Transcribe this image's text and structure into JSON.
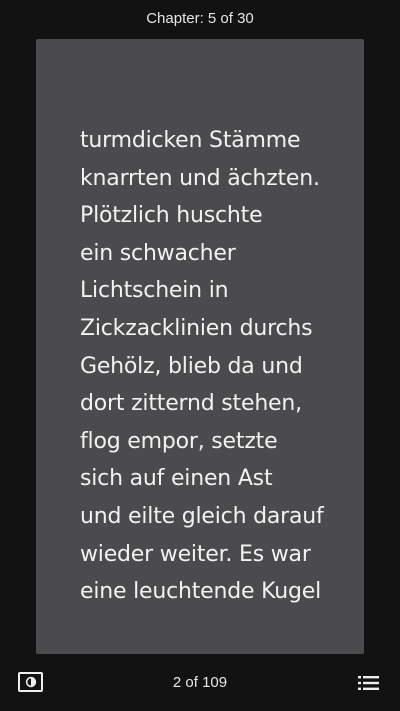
{
  "header": {
    "chapter_label": "Chapter: 5 of 30"
  },
  "page": {
    "lines": [
      "turmdicken Stämme",
      "knarrten und ächzten.",
      "Plötzlich huschte",
      "ein schwacher",
      "Lichtschein in",
      "Zickzacklinien durchs",
      "Gehölz, blieb da und",
      "dort zitternd stehen,",
      "flog empor, setzte",
      "sich auf einen Ast",
      "und eilte gleich darauf",
      "wieder weiter. Es war",
      "eine leuchtende Kugel"
    ]
  },
  "footer": {
    "page_counter": "2 of 109",
    "theme_icon": "brightness-contrast-icon",
    "toc_icon": "list-menu-icon"
  },
  "colors": {
    "background": "#131213",
    "page": "#4b4a4c",
    "text": "#f2f2f2"
  }
}
